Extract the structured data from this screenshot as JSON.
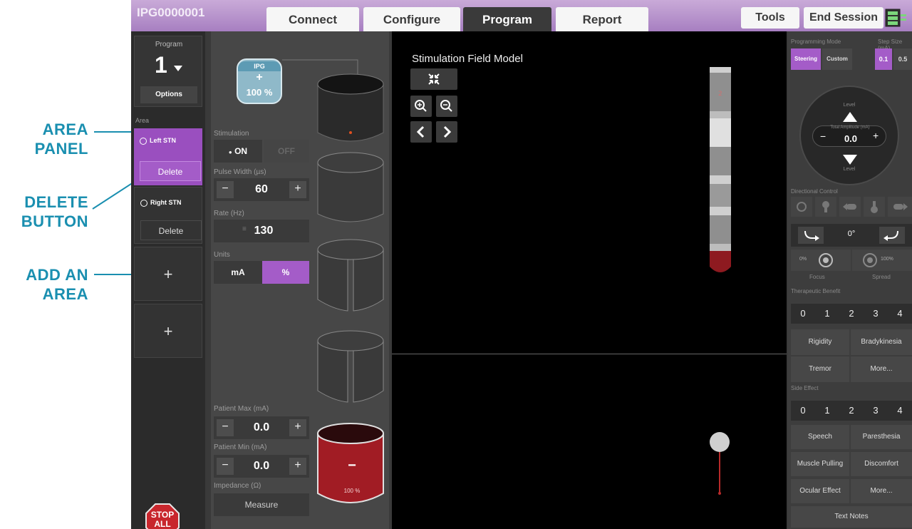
{
  "annotations": {
    "area_panel": [
      "AREA",
      "PANEL"
    ],
    "delete_button": [
      "DELETE",
      "BUTTON"
    ],
    "add_area": [
      "ADD AN",
      "AREA"
    ]
  },
  "header": {
    "ipg_id": "IPG0000001",
    "tabs": [
      {
        "label": "Connect",
        "active": false
      },
      {
        "label": "Configure",
        "active": false
      },
      {
        "label": "Program",
        "active": true
      },
      {
        "label": "Report",
        "active": false
      }
    ],
    "tools_label": "Tools",
    "end_session_label": "End Session"
  },
  "left": {
    "program_label": "Program",
    "program_number": "1",
    "options_label": "Options",
    "area_label": "Area",
    "areas": [
      {
        "name": "Left STN",
        "delete_label": "Delete",
        "selected": true
      },
      {
        "name": "Right STN",
        "delete_label": "Delete",
        "selected": false
      }
    ],
    "add_label": "+",
    "stop_label": "STOP",
    "all_label": "ALL"
  },
  "controls": {
    "ipg_label": "IPG",
    "ipg_sign": "+",
    "ipg_percent": "100 %",
    "stimulation_label": "Stimulation",
    "on_label": "ON",
    "off_label": "OFF",
    "pulse_width_label": "Pulse Width (µs)",
    "pulse_width_value": "60",
    "rate_label": "Rate (Hz)",
    "rate_value": "130",
    "units_label": "Units",
    "unit_ma": "mA",
    "unit_pct": "%",
    "patient_max_label": "Patient Max (mA)",
    "patient_max_value": "0.0",
    "patient_min_label": "Patient Min (mA)",
    "patient_min_value": "0.0",
    "impedance_label": "Impedance (Ω)",
    "measure_label": "Measure",
    "minus": "−",
    "plus": "+",
    "contact_sign": "−",
    "contact_percent": "100 %"
  },
  "viewer": {
    "title": "Stimulation Field Model"
  },
  "right": {
    "programming_mode_label": "Programming Mode",
    "step_size_label": "Step Size (mA)",
    "steering_label": "Steering",
    "custom_label": "Custom",
    "step_01": "0.1",
    "step_05": "0.5",
    "level_top": "Level",
    "total_amp_label": "Total Amplitude (mA)",
    "total_amp_value": "0.0",
    "level_bottom": "Level",
    "directional_label": "Directional Control",
    "angle_value": "0°",
    "focus_pct": "0%",
    "spread_pct": "100%",
    "focus_label": "Focus",
    "spread_label": "Spread",
    "therapeutic_label": "Therapeutic Benefit",
    "numbers": [
      "0",
      "1",
      "2",
      "3",
      "4"
    ],
    "rigidity": "Rigidity",
    "bradykinesia": "Bradykinesia",
    "tremor": "Tremor",
    "more": "More...",
    "side_effect_label": "Side Effect",
    "speech": "Speech",
    "paresthesia": "Paresthesia",
    "muscle_pulling": "Muscle Pulling",
    "discomfort": "Discomfort",
    "ocular_effect": "Ocular Effect",
    "text_notes": "Text Notes"
  },
  "colors": {
    "accent_purple": "#a45cc8",
    "annotation_blue": "#1a8fb0",
    "contact_red": "#a11c24"
  }
}
